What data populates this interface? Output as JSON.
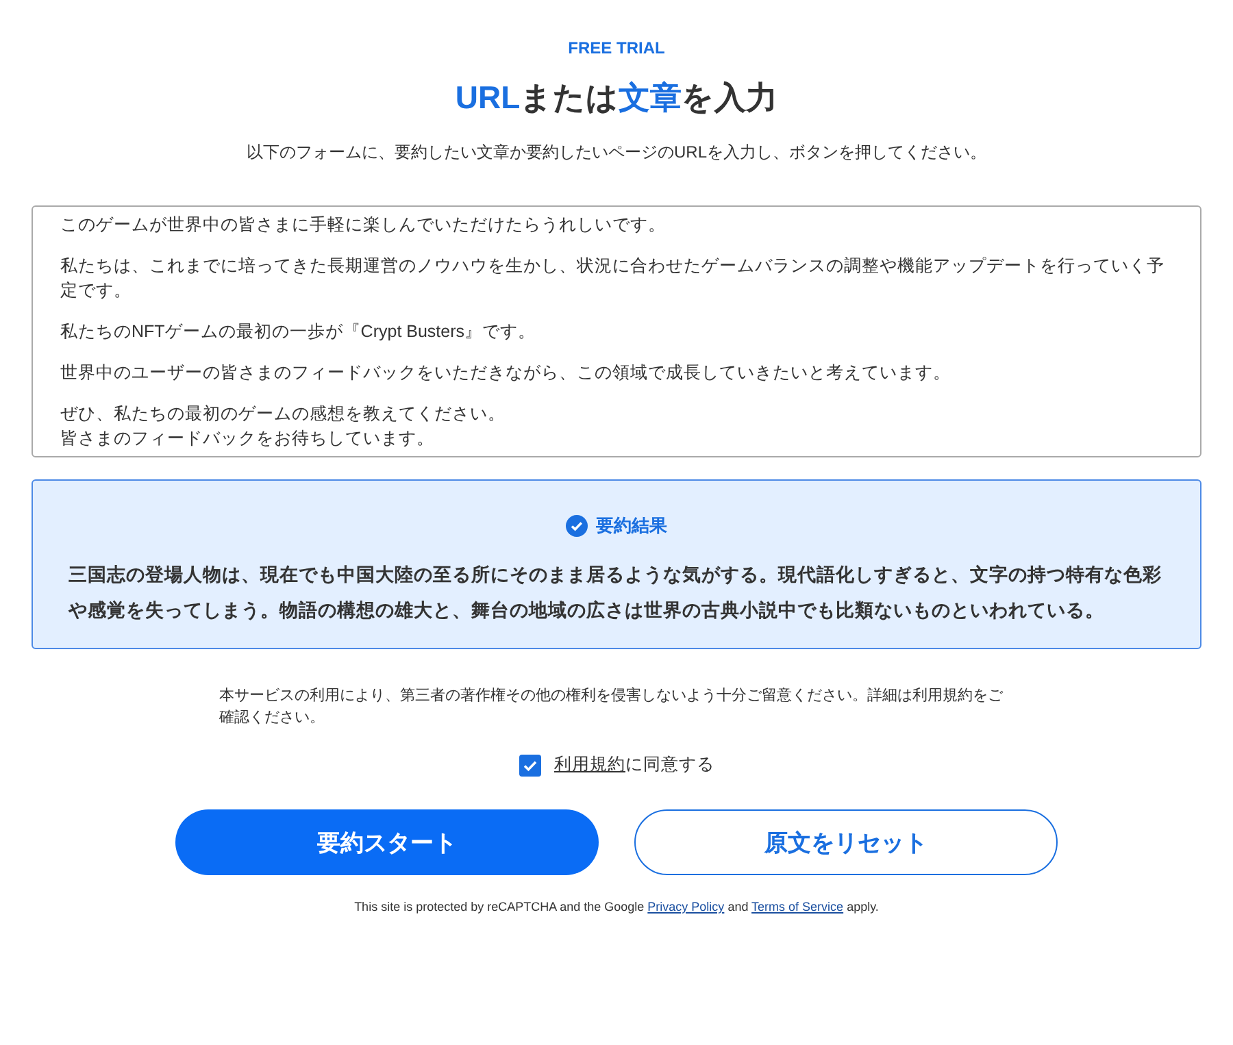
{
  "eyebrow": "FREE TRIAL",
  "title": [
    {
      "text": "URL",
      "highlight": true
    },
    {
      "text": "または",
      "highlight": false
    },
    {
      "text": "文章",
      "highlight": true
    },
    {
      "text": "を入力",
      "highlight": false
    }
  ],
  "subtitle": "以下のフォームに、要約したい文章か要約したいページのURLを入力し、ボタンを押してください。",
  "text_input": {
    "paragraphs": [
      [
        "このゲームが世界中の皆さまに手軽に楽しんでいただけたらうれしいです。"
      ],
      [
        "私たちは、これまでに培ってきた長期運営のノウハウを生かし、状況に合わせたゲームバランスの調整や機能アップデートを行っていく予定です。"
      ],
      [
        "私たちのNFTゲームの最初の一歩が『Crypt Busters』です。"
      ],
      [
        "世界中のユーザーの皆さまのフィードバックをいただきながら、この領域で成長していきたいと考えています。"
      ],
      [
        "ぜひ、私たちの最初のゲームの感想を教えてください。",
        "皆さまのフィードバックをお待ちしています。"
      ]
    ]
  },
  "result": {
    "heading": "要約結果",
    "text": "三国志の登場人物は、現在でも中国大陸の至る所にそのまま居るような気がする。現代語化しすぎると、文字の持つ特有な色彩や感覚を失ってしまう。物語の構想の雄大と、舞台の地域の広さは世界の古典小説中でも比類ないものといわれている。"
  },
  "notice": "本サービスの利用により、第三者の著作権その他の権利を侵害しないよう十分ご留意ください。詳細は利用規約をご確認ください。",
  "agreement": {
    "checked": true,
    "link": "利用規約",
    "label": "に同意する"
  },
  "buttons": [
    {
      "label": "要約スタート",
      "kind": "primary"
    },
    {
      "label": "原文をリセット",
      "kind": "secondary"
    }
  ],
  "footer": [
    {
      "text": "This site is protected by reCAPTCHA and the Google ",
      "link": false
    },
    {
      "text": "Privacy Policy",
      "link": true
    },
    {
      "text": " and ",
      "link": false
    },
    {
      "text": "Terms of Service",
      "link": true
    },
    {
      "text": " apply.",
      "link": false
    }
  ]
}
